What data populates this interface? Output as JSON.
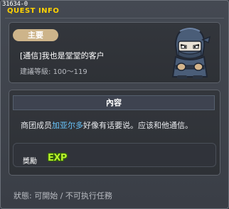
{
  "window": {
    "quest_id": "31634-0",
    "title": "QUEST INFO"
  },
  "quest": {
    "category_badge": "主要",
    "name": "[通信]我也是堂堂的客户",
    "level_label": "建議等級:",
    "level_range": "100～119",
    "npc_icon": "ninja-npc-icon"
  },
  "content": {
    "header": "內容",
    "text_before": "商团成员",
    "npc_name": "加亚尔多",
    "text_after": "好像有话要说。应该和他通信。"
  },
  "reward": {
    "label": "獎勵",
    "exp_text": "EXP"
  },
  "status": {
    "text": "狀態: 可開始 / 不可执行任務"
  },
  "colors": {
    "title": "#ffd200",
    "badge": "#cdb48a",
    "highlight": "#69c7ff",
    "exp": "#b7f22a"
  }
}
